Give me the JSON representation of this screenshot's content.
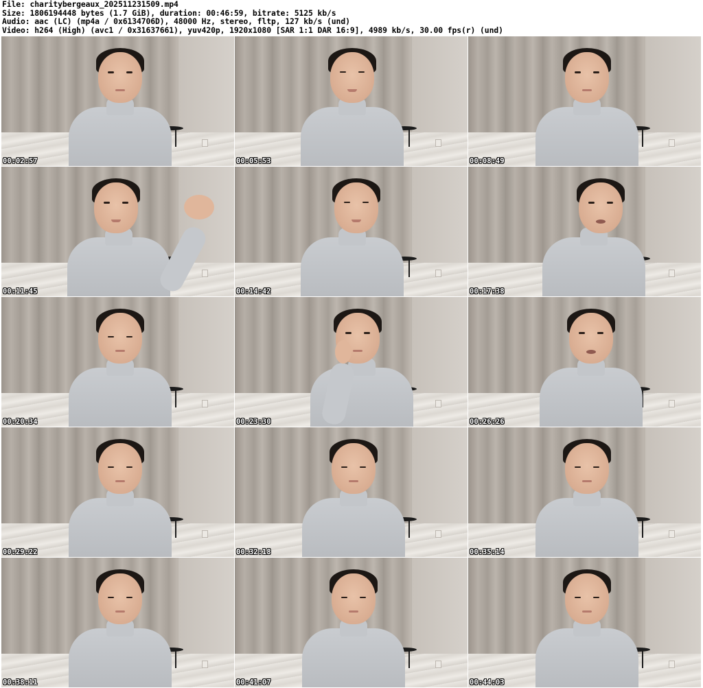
{
  "header": {
    "file_line": "File: charitybergeaux_202511231509.mp4",
    "size_line": "Size: 1806194448 bytes (1.7 GiB), duration: 00:46:59, bitrate: 5125 kb/s",
    "audio_line": "Audio: aac (LC) (mp4a / 0x6134706D), 48000 Hz, stereo, fltp, 127 kb/s (und)",
    "video_line": "Video: h264 (High) (avc1 / 0x31637661), yuv420p, 1920x1080 [SAR 1:1 DAR 16:9], 4989 kb/s, 30.00 fps(r) (und)"
  },
  "thumbnails": [
    {
      "timestamp": "00:02:57",
      "pose": "center-look"
    },
    {
      "timestamp": "00:05:53",
      "pose": "center-smile"
    },
    {
      "timestamp": "00:08:49",
      "pose": "center-look"
    },
    {
      "timestamp": "00:11:45",
      "pose": "left-wave"
    },
    {
      "timestamp": "00:14:42",
      "pose": "center-turn"
    },
    {
      "timestamp": "00:17:38",
      "pose": "right-talk"
    },
    {
      "timestamp": "00:20:34",
      "pose": "center-down"
    },
    {
      "timestamp": "00:23:30",
      "pose": "chin-rest"
    },
    {
      "timestamp": "00:26:26",
      "pose": "center-talk"
    },
    {
      "timestamp": "00:29:22",
      "pose": "center-down"
    },
    {
      "timestamp": "00:32:18",
      "pose": "center-down"
    },
    {
      "timestamp": "00:35:14",
      "pose": "center-down"
    },
    {
      "timestamp": "00:38:11",
      "pose": "center-down"
    },
    {
      "timestamp": "00:41:07",
      "pose": "center-down"
    },
    {
      "timestamp": "00:44:03",
      "pose": "center-down"
    }
  ]
}
